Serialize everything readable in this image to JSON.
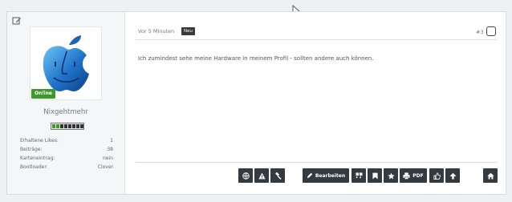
{
  "user": {
    "online_label": "Online",
    "username": "Nixgehtmehr",
    "stats": [
      {
        "label": "Erhaltene Likes:",
        "value": "1"
      },
      {
        "label": "Beiträge:",
        "value": "38"
      },
      {
        "label": "Karteneintrag:",
        "value": "nein"
      },
      {
        "label": "Bootloader:",
        "value": "Clover"
      }
    ]
  },
  "post": {
    "time": "Vor 5 Minuten",
    "new_label": "Neu",
    "number": "#3",
    "message": "Ich zumindest sehe meine Hardware in meinem Profil - sollten andere auch können."
  },
  "toolbar": {
    "edit_label": "Bearbeiten",
    "pdf_label": "PDF"
  },
  "icons": [
    "cursor-icon",
    "edit-icon",
    "apple-logo",
    "globe-icon",
    "warning-icon",
    "gavel-icon",
    "pencil-icon",
    "quote-icon",
    "bookmark-icon",
    "star-icon",
    "print-icon",
    "like-icon",
    "arrow-up-icon",
    "home-icon"
  ],
  "colors": {
    "online": "#3c9a2a",
    "toolbar_bg": "#333a40",
    "new_badge": "#3a3a3a"
  }
}
